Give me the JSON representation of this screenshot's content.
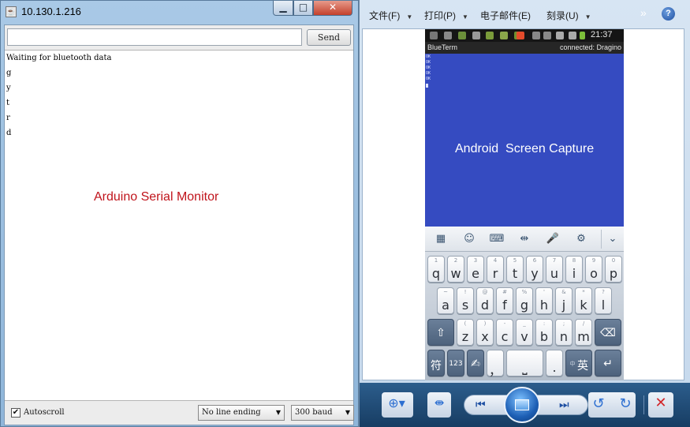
{
  "serial_monitor": {
    "title": "10.130.1.216",
    "send_label": "Send",
    "input_value": "",
    "output_lines": [
      "Waiting for bluetooth data",
      "g",
      "y",
      "t",
      "r",
      "d"
    ],
    "overlay_label": "Arduino Serial Monitor",
    "autoscroll_label": "Autoscroll",
    "autoscroll_checked": true,
    "line_ending": "No line ending",
    "baud": "300 baud"
  },
  "viewer": {
    "menu": {
      "file": "文件(F)",
      "print": "打印(P)",
      "email": "电子邮件(E)",
      "burn": "刻录(U)"
    },
    "help_label": "?",
    "phone": {
      "time": "21:37",
      "app_name": "BlueTerm",
      "connection": "connected: Dragino",
      "terminal_lines": [
        "OK",
        "OK",
        "OK",
        "OK",
        "OK"
      ],
      "caption": "Android  Screen Capture",
      "keyboard": {
        "row1": [
          {
            "sub": "1",
            "key": "q"
          },
          {
            "sub": "2",
            "key": "w"
          },
          {
            "sub": "3",
            "key": "e"
          },
          {
            "sub": "4",
            "key": "r"
          },
          {
            "sub": "5",
            "key": "t"
          },
          {
            "sub": "6",
            "key": "y"
          },
          {
            "sub": "7",
            "key": "u"
          },
          {
            "sub": "8",
            "key": "i"
          },
          {
            "sub": "9",
            "key": "o"
          },
          {
            "sub": "0",
            "key": "p"
          }
        ],
        "row2": [
          {
            "sub": "~",
            "key": "a"
          },
          {
            "sub": "!",
            "key": "s"
          },
          {
            "sub": "@",
            "key": "d"
          },
          {
            "sub": "#",
            "key": "f"
          },
          {
            "sub": "%",
            "key": "g"
          },
          {
            "sub": "'",
            "key": "h"
          },
          {
            "sub": "&",
            "key": "j"
          },
          {
            "sub": "*",
            "key": "k"
          },
          {
            "sub": "?",
            "key": "l"
          }
        ],
        "row3": [
          {
            "sub": "(",
            "key": "z"
          },
          {
            "sub": ")",
            "key": "x"
          },
          {
            "sub": "-",
            "key": "c"
          },
          {
            "sub": "_",
            "key": "v"
          },
          {
            "sub": ":",
            "key": "b"
          },
          {
            "sub": ";",
            "key": "n"
          },
          {
            "sub": "/",
            "key": "m"
          }
        ],
        "symbol_key": "符",
        "num_key": "123",
        "comma_key": "，",
        "period_key": ".",
        "lang_sub": "中",
        "lang_key": "英"
      }
    }
  }
}
